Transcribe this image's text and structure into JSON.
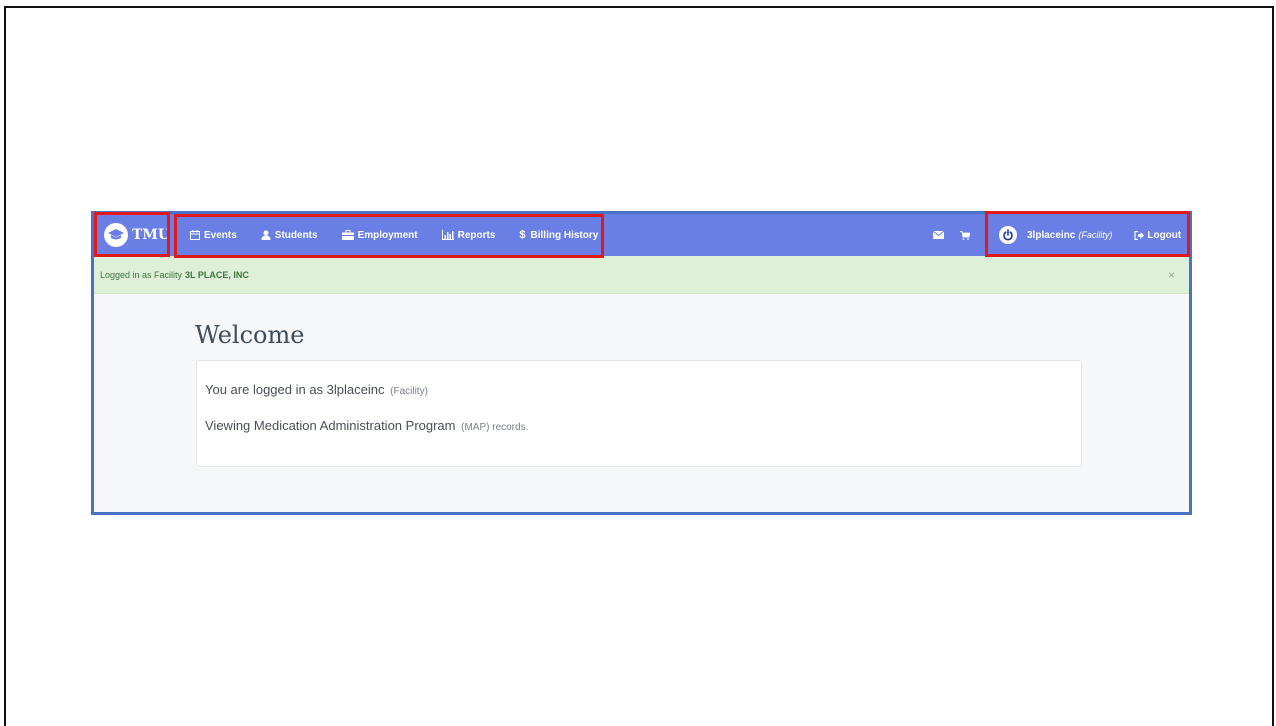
{
  "brand": {
    "name": "TMU"
  },
  "nav": {
    "items": [
      {
        "label": "Events",
        "icon": "calendar-icon"
      },
      {
        "label": "Students",
        "icon": "user-icon"
      },
      {
        "label": "Employment",
        "icon": "briefcase-icon"
      },
      {
        "label": "Reports",
        "icon": "bar-chart-icon"
      },
      {
        "label": "Billing History",
        "icon": "dollar-icon"
      }
    ]
  },
  "user": {
    "name": "3lplaceinc",
    "role": "(Facility)",
    "logout_label": "Logout"
  },
  "alert": {
    "prefix": "Logged in as Facility",
    "entity": "3L PLACE, INC",
    "close": "×"
  },
  "main": {
    "title": "Welcome",
    "line1": {
      "text": "You are logged in as 3lplaceinc",
      "muted": "(Facility)"
    },
    "line2": {
      "text": "Viewing Medication Administration Program",
      "muted": "(MAP) records."
    }
  },
  "colors": {
    "navbar": "#6a7fe6",
    "alert_bg": "#dff0d8",
    "highlight": "#e01919",
    "frame": "#4a72c4"
  }
}
